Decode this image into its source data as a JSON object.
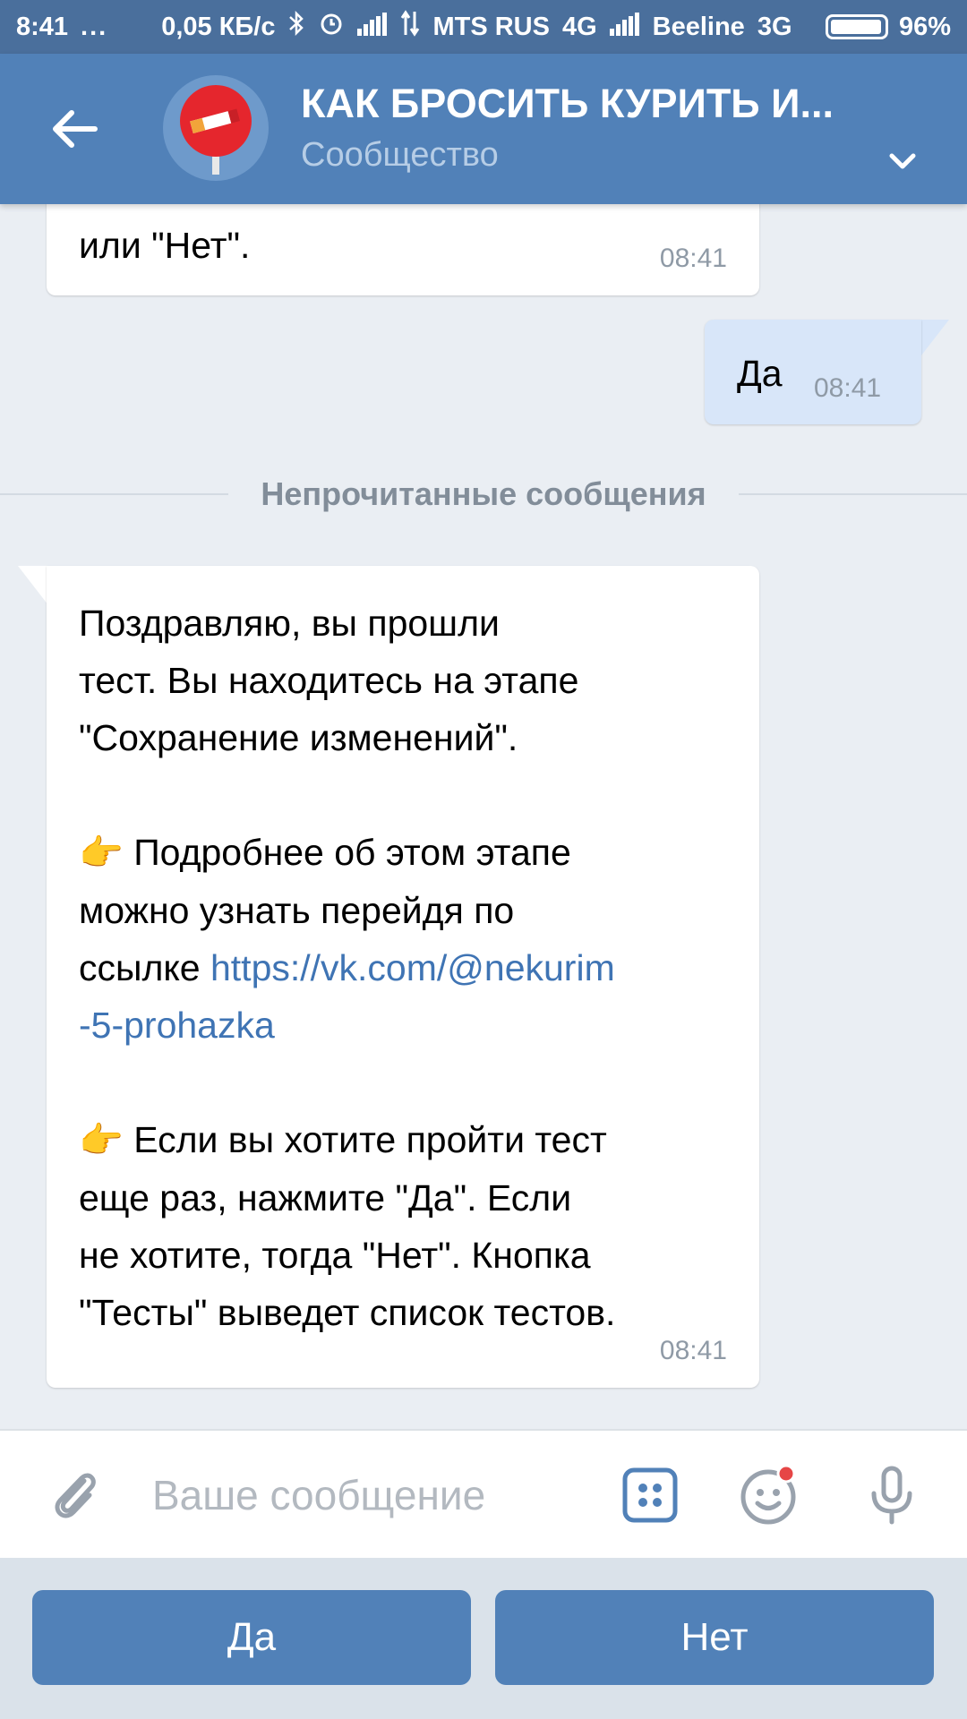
{
  "status_bar": {
    "time": "8:41",
    "dots": "...",
    "speed": "0,05 КБ/с",
    "carrier1": "MTS RUS",
    "network1": "4G",
    "carrier2": "Beeline",
    "network2": "3G",
    "battery": "96%",
    "battery_level": 0.96
  },
  "header": {
    "title": "КАК БРОСИТЬ КУРИТЬ И...",
    "subtitle": "Сообщество"
  },
  "messages": {
    "previous": {
      "text": "или \"Нет\".",
      "time": "08:41"
    },
    "outgoing": {
      "text": "Да",
      "time": "08:41"
    },
    "divider": "Непрочитанные сообщения",
    "incoming": {
      "para1": "Поздравляю, вы прошли\nтест. Вы находитесь на этапе\n\"Сохранение изменений\".",
      "para2_prefix": " Подробнее об этом этапе\nможно узнать перейдя по\nссылке ",
      "link": "https://vk.com/@nekurim\n-5-prohazka",
      "para3": " Если вы хотите пройти тест\nеще раз, нажмите \"Да\". Если\nне хотите, тогда \"Нет\". Кнопка\n\"Тесты\" выведет список тестов.",
      "emoji": "👉",
      "time": "08:41"
    }
  },
  "input": {
    "placeholder": "Ваше сообщение"
  },
  "keyboard": {
    "yes_label": "Да",
    "no_label": "Нет"
  },
  "colors": {
    "header": "#5181b8",
    "status_bar": "#4a6f9c",
    "accent": "#3f74b4",
    "notification_dot": "#e64646"
  }
}
